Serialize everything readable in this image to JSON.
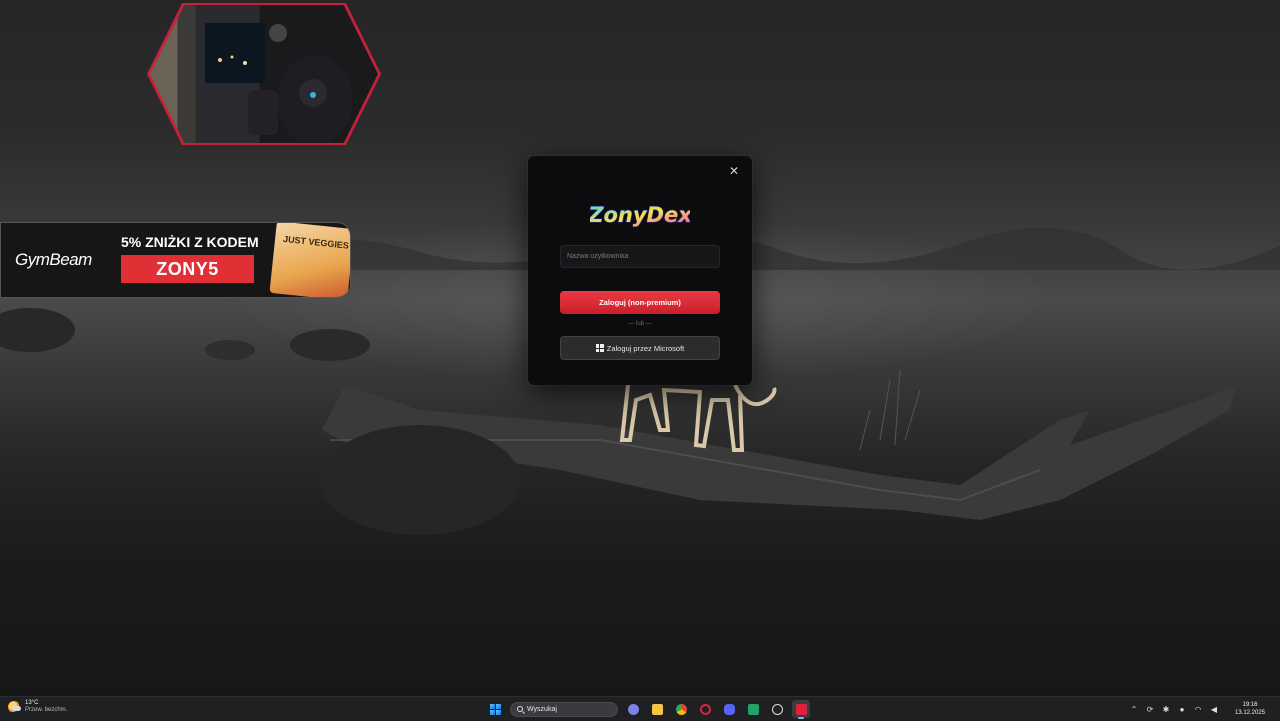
{
  "ad": {
    "brand": "GymBeam",
    "promo_text": "5% ZNIŻKI Z KODEM",
    "promo_code": "ZONY5",
    "product_text": "JUST VEGGIES"
  },
  "login": {
    "logo_text": "ZonyDex",
    "close_glyph": "✕",
    "username_placeholder": "Nazwa użytkownika",
    "login_button": "Zaloguj (non-premium)",
    "divider": "— lub —",
    "microsoft_button": "Zaloguj przez Microsoft"
  },
  "taskbar": {
    "weather_temp": "13°C",
    "weather_desc": "Przew. bezchm.",
    "search_placeholder": "Wyszukaj",
    "apps": [
      {
        "name": "teams-icon",
        "color": "#7b83eb"
      },
      {
        "name": "file-explorer-icon",
        "color": "#f5c542"
      },
      {
        "name": "chrome-icon",
        "color": "#34a853"
      },
      {
        "name": "opera-icon",
        "color": "#e0203a"
      },
      {
        "name": "discord-icon",
        "color": "#5865f2"
      },
      {
        "name": "excel-like-icon",
        "color": "#21a366"
      },
      {
        "name": "obs-icon",
        "color": "#444"
      },
      {
        "name": "zonydex-app-icon",
        "color": "#e0203a"
      }
    ],
    "time": "19:16",
    "date": "13.12.2025"
  }
}
